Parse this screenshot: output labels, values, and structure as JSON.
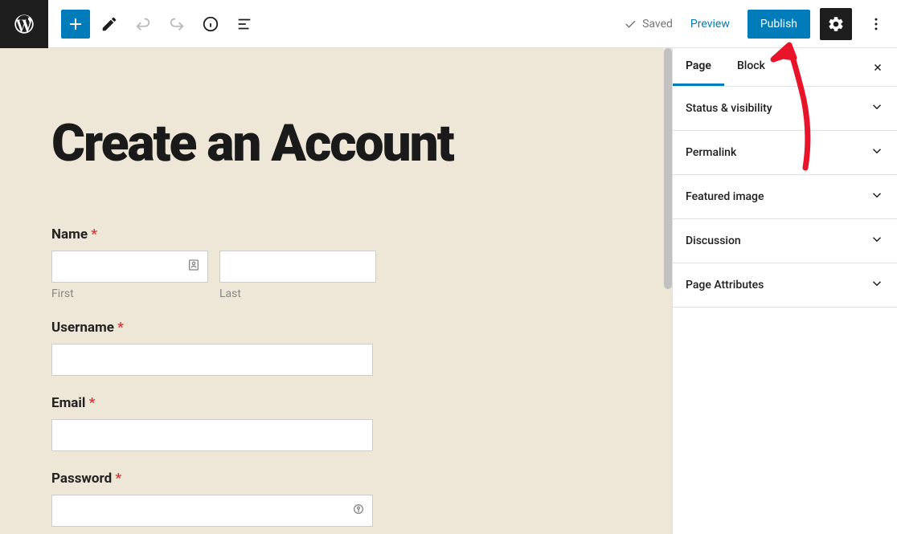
{
  "toolbar": {
    "saved_label": "Saved",
    "preview_label": "Preview",
    "publish_label": "Publish"
  },
  "sidebar": {
    "tabs": [
      {
        "label": "Page",
        "active": true
      },
      {
        "label": "Block",
        "active": false
      }
    ],
    "panels": [
      {
        "label": "Status & visibility"
      },
      {
        "label": "Permalink"
      },
      {
        "label": "Featured image"
      },
      {
        "label": "Discussion"
      },
      {
        "label": "Page Attributes"
      }
    ]
  },
  "page": {
    "title": "Create an Account",
    "form": {
      "name": {
        "label": "Name",
        "first_sublabel": "First",
        "last_sublabel": "Last"
      },
      "username": {
        "label": "Username"
      },
      "email": {
        "label": "Email"
      },
      "password": {
        "label": "Password"
      }
    },
    "required_marker": "*"
  }
}
